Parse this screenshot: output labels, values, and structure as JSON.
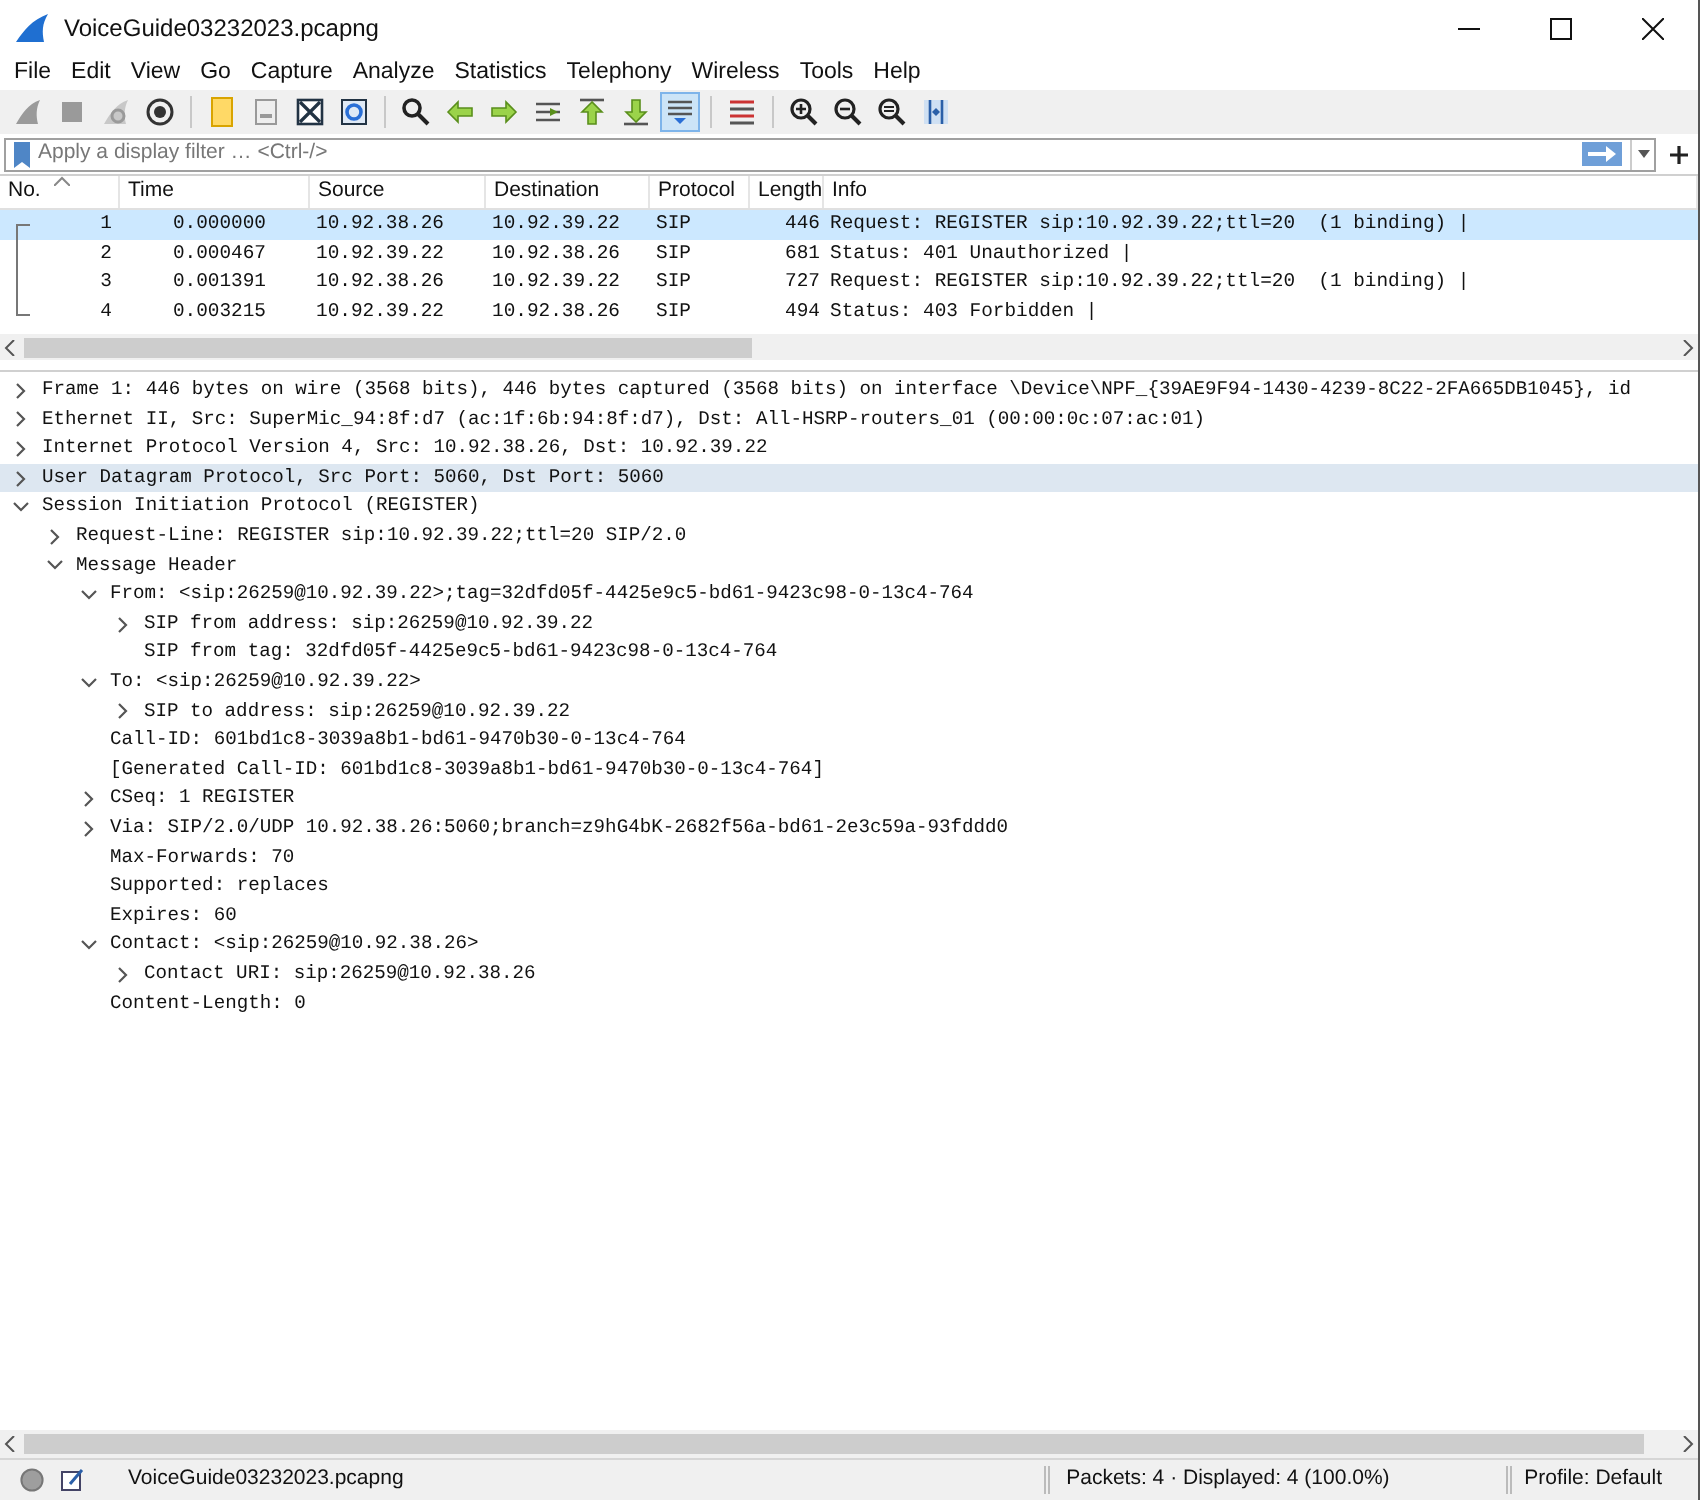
{
  "window": {
    "title": "VoiceGuide03232023.pcapng"
  },
  "menu": [
    "File",
    "Edit",
    "View",
    "Go",
    "Capture",
    "Analyze",
    "Statistics",
    "Telephony",
    "Wireless",
    "Tools",
    "Help"
  ],
  "toolbar": [
    [
      {
        "kind": "fin",
        "pressed": false
      },
      {
        "kind": "stop",
        "pressed": false
      },
      {
        "kind": "restart",
        "pressed": false
      },
      {
        "kind": "options",
        "pressed": false
      }
    ],
    [
      {
        "kind": "open",
        "pressed": false
      },
      {
        "kind": "save",
        "pressed": false
      },
      {
        "kind": "close",
        "pressed": false
      },
      {
        "kind": "reload",
        "pressed": false
      }
    ],
    [
      {
        "kind": "find",
        "pressed": false
      },
      {
        "kind": "back",
        "pressed": false
      },
      {
        "kind": "forward",
        "pressed": false
      },
      {
        "kind": "goto",
        "pressed": false
      },
      {
        "kind": "first",
        "pressed": false
      },
      {
        "kind": "last",
        "pressed": false
      },
      {
        "kind": "autoscroll",
        "pressed": true
      }
    ],
    [
      {
        "kind": "colorize",
        "pressed": false
      }
    ],
    [
      {
        "kind": "zoomin",
        "pressed": false
      },
      {
        "kind": "zoomout",
        "pressed": false
      },
      {
        "kind": "zoomreset",
        "pressed": false
      },
      {
        "kind": "resize",
        "pressed": false
      }
    ]
  ],
  "filter": {
    "placeholder": "Apply a display filter … <Ctrl-/>"
  },
  "packet_list": {
    "columns": [
      "No.",
      "Time",
      "Source",
      "Destination",
      "Protocol",
      "Length",
      "Info"
    ],
    "rows": [
      {
        "cells": [
          "1",
          "0.000000",
          "10.92.38.26",
          "10.92.39.22",
          "SIP",
          "446",
          "Request: REGISTER sip:10.92.39.22;ttl=20  (1 binding) |"
        ],
        "selected": true
      },
      {
        "cells": [
          "2",
          "0.000467",
          "10.92.39.22",
          "10.92.38.26",
          "SIP",
          "681",
          "Status: 401 Unauthorized |"
        ],
        "selected": false
      },
      {
        "cells": [
          "3",
          "0.001391",
          "10.92.38.26",
          "10.92.39.22",
          "SIP",
          "727",
          "Request: REGISTER sip:10.92.39.22;ttl=20  (1 binding) |"
        ],
        "selected": false
      },
      {
        "cells": [
          "4",
          "0.003215",
          "10.92.39.22",
          "10.92.38.26",
          "SIP",
          "494",
          "Status: 403 Forbidden |"
        ],
        "selected": false
      }
    ]
  },
  "details": [
    {
      "text": "Frame 1: 446 bytes on wire (3568 bits), 446 bytes captured (3568 bits) on interface \\Device\\NPF_{39AE9F94-1430-4239-8C22-2FA665DB1045}, id",
      "kind": "node",
      "expanded": false,
      "selected": false
    },
    {
      "text": "Ethernet II, Src: SuperMic_94:8f:d7 (ac:1f:6b:94:8f:d7), Dst: All-HSRP-routers_01 (00:00:0c:07:ac:01)",
      "kind": "node",
      "expanded": false,
      "selected": false
    },
    {
      "text": "Internet Protocol Version 4, Src: 10.92.38.26, Dst: 10.92.39.22",
      "kind": "node",
      "expanded": false,
      "selected": false
    },
    {
      "text": "User Datagram Protocol, Src Port: 5060, Dst Port: 5060",
      "kind": "node",
      "expanded": false,
      "selected": true
    },
    {
      "text": "Session Initiation Protocol (REGISTER)",
      "kind": "node",
      "expanded": true,
      "selected": false,
      "children": [
        {
          "text": "Request-Line: REGISTER sip:10.92.39.22;ttl=20 SIP/2.0",
          "kind": "node",
          "expanded": false,
          "selected": false
        },
        {
          "text": "Message Header",
          "kind": "node",
          "expanded": true,
          "selected": false,
          "children": [
            {
              "text": "From: <sip:26259@10.92.39.22>;tag=32dfd05f-4425e9c5-bd61-9423c98-0-13c4-764",
              "kind": "node",
              "expanded": true,
              "selected": false,
              "children": [
                {
                  "text": "SIP from address: sip:26259@10.92.39.22",
                  "kind": "node",
                  "expanded": false,
                  "selected": false
                },
                {
                  "text": "SIP from tag: 32dfd05f-4425e9c5-bd61-9423c98-0-13c4-764",
                  "kind": "leaf",
                  "selected": false
                }
              ]
            },
            {
              "text": "To: <sip:26259@10.92.39.22>",
              "kind": "node",
              "expanded": true,
              "selected": false,
              "children": [
                {
                  "text": "SIP to address: sip:26259@10.92.39.22",
                  "kind": "node",
                  "expanded": false,
                  "selected": false
                }
              ]
            },
            {
              "text": "Call-ID: 601bd1c8-3039a8b1-bd61-9470b30-0-13c4-764",
              "kind": "leaf",
              "selected": false
            },
            {
              "text": "[Generated Call-ID: 601bd1c8-3039a8b1-bd61-9470b30-0-13c4-764]",
              "kind": "leaf",
              "selected": false
            },
            {
              "text": "CSeq: 1 REGISTER",
              "kind": "node",
              "expanded": false,
              "selected": false
            },
            {
              "text": "Via: SIP/2.0/UDP 10.92.38.26:5060;branch=z9hG4bK-2682f56a-bd61-2e3c59a-93fddd0",
              "kind": "node",
              "expanded": false,
              "selected": false
            },
            {
              "text": "Max-Forwards: 70",
              "kind": "leaf",
              "selected": false
            },
            {
              "text": "Supported: replaces",
              "kind": "leaf",
              "selected": false
            },
            {
              "text": "Expires: 60",
              "kind": "leaf",
              "selected": false
            },
            {
              "text": "Contact: <sip:26259@10.92.38.26>",
              "kind": "node",
              "expanded": true,
              "selected": false,
              "children": [
                {
                  "text": "Contact URI: sip:26259@10.92.38.26",
                  "kind": "node",
                  "expanded": false,
                  "selected": false
                }
              ]
            },
            {
              "text": "Content-Length: 0",
              "kind": "leaf",
              "selected": false
            }
          ]
        }
      ]
    }
  ],
  "status_bar": {
    "file": "VoiceGuide03232023.pcapng",
    "packets": "Packets: 4 · Displayed: 4 (100.0%)",
    "profile": "Profile: Default"
  }
}
